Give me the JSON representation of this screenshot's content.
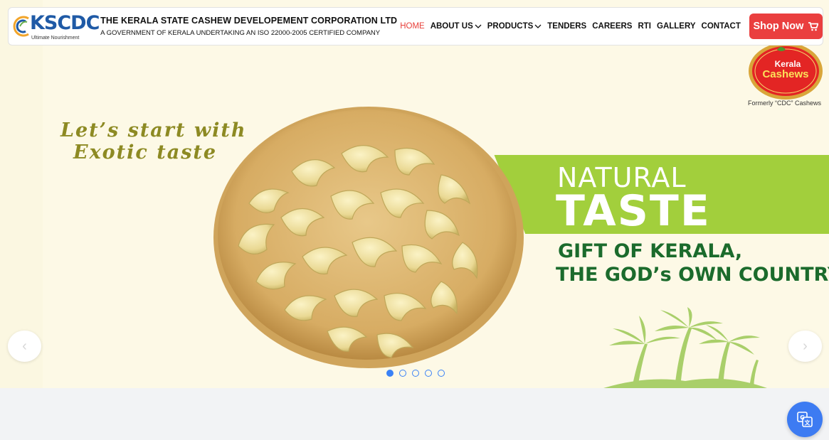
{
  "header": {
    "logo_text": "KSCDC",
    "logo_tagline": "Ultimate Nourishment",
    "org_name": "THE KERALA STATE CASHEW DEVELOPEMENT CORPORATION LTD",
    "org_subtitle": "A GOVERNMENT OF KERALA UNDERTAKING AN ISO 22000-2005 CERTIFIED COMPANY",
    "nav": [
      {
        "label": "HOME",
        "active": true
      },
      {
        "label": "ABOUT US",
        "dropdown": true
      },
      {
        "label": "PRODUCTS",
        "dropdown": true
      },
      {
        "label": "TENDERS"
      },
      {
        "label": "CAREERS"
      },
      {
        "label": "RTI"
      },
      {
        "label": "GALLERY"
      },
      {
        "label": "CONTACT"
      }
    ],
    "shop_label": "Shop Now",
    "shop_icon": "cart-icon"
  },
  "badge": {
    "brand": "Kerala Cashews",
    "caption": "Formerly “CDC” Cashews"
  },
  "slide": {
    "slogan_line1": "Let’s start with",
    "slogan_line2": "Exotic taste",
    "headline_small": "NATURAL",
    "headline_big": "TASTE",
    "gift_line1": "GIFT OF KERALA,",
    "gift_line2": "THE GOD’s OWN COUNTRY"
  },
  "carousel": {
    "prev_icon": "chevron-left-icon",
    "next_icon": "chevron-right-icon",
    "slide_count": 5,
    "active_index": 0
  },
  "translate_icon": "translate-icon",
  "colors": {
    "brand_blue": "#1f5aa6",
    "nav_active": "#e8403a",
    "shop_button": "#ea3f3f",
    "banner_green": "#a2cf3c",
    "heading_green": "#1b6b2c",
    "slogan_olive": "#8d8a23",
    "dot_blue": "#3b82f6"
  }
}
